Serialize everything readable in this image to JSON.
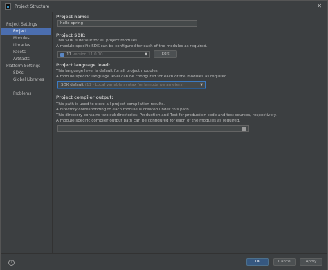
{
  "window": {
    "title": "Project Structure",
    "close_glyph": "✕"
  },
  "sidebar": {
    "sections": [
      {
        "label": "Project Settings",
        "items": [
          "Project",
          "Modules",
          "Libraries",
          "Facets",
          "Artifacts"
        ]
      },
      {
        "label": "Platform Settings",
        "items": [
          "SDKs",
          "Global Libraries"
        ]
      }
    ],
    "extra": "Problems",
    "active": "Project"
  },
  "project_name": {
    "label": "Project name:",
    "value": "hello-spring"
  },
  "project_sdk": {
    "label": "Project SDK:",
    "desc1": "This SDK is default for all project modules.",
    "desc2": "A module specific SDK can be configured for each of the modules as required.",
    "value_main": "11",
    "value_muted": "version 11.0.10",
    "edit_label": "Edit"
  },
  "language_level": {
    "label": "Project language level:",
    "desc1": "This language level is default for all project modules.",
    "desc2": "A module specific language level can be configured for each of the modules as required.",
    "value_main": "SDK default",
    "value_muted": "(11 - Local variable syntax for lambda parameters)"
  },
  "compiler_output": {
    "label": "Project compiler output:",
    "desc1": "This path is used to store all project compilation results.",
    "desc2": "A directory corresponding to each module is created under this path.",
    "desc3": "This directory contains two subdirectories: Production and Test for production code and test sources, respectively.",
    "desc4": "A module specific compiler output path can be configured for each of the modules as required.",
    "value": ""
  },
  "footer": {
    "help": "?",
    "ok": "OK",
    "cancel": "Cancel",
    "apply": "Apply"
  },
  "colors": {
    "selection": "#4b6eaf",
    "primary_button": "#365880",
    "focus": "#3d7bc2"
  },
  "icons": {
    "sdk": "jdk-folder-icon",
    "dropdown": "chevron-down-icon",
    "browse": "folder-icon",
    "help": "help-icon"
  }
}
